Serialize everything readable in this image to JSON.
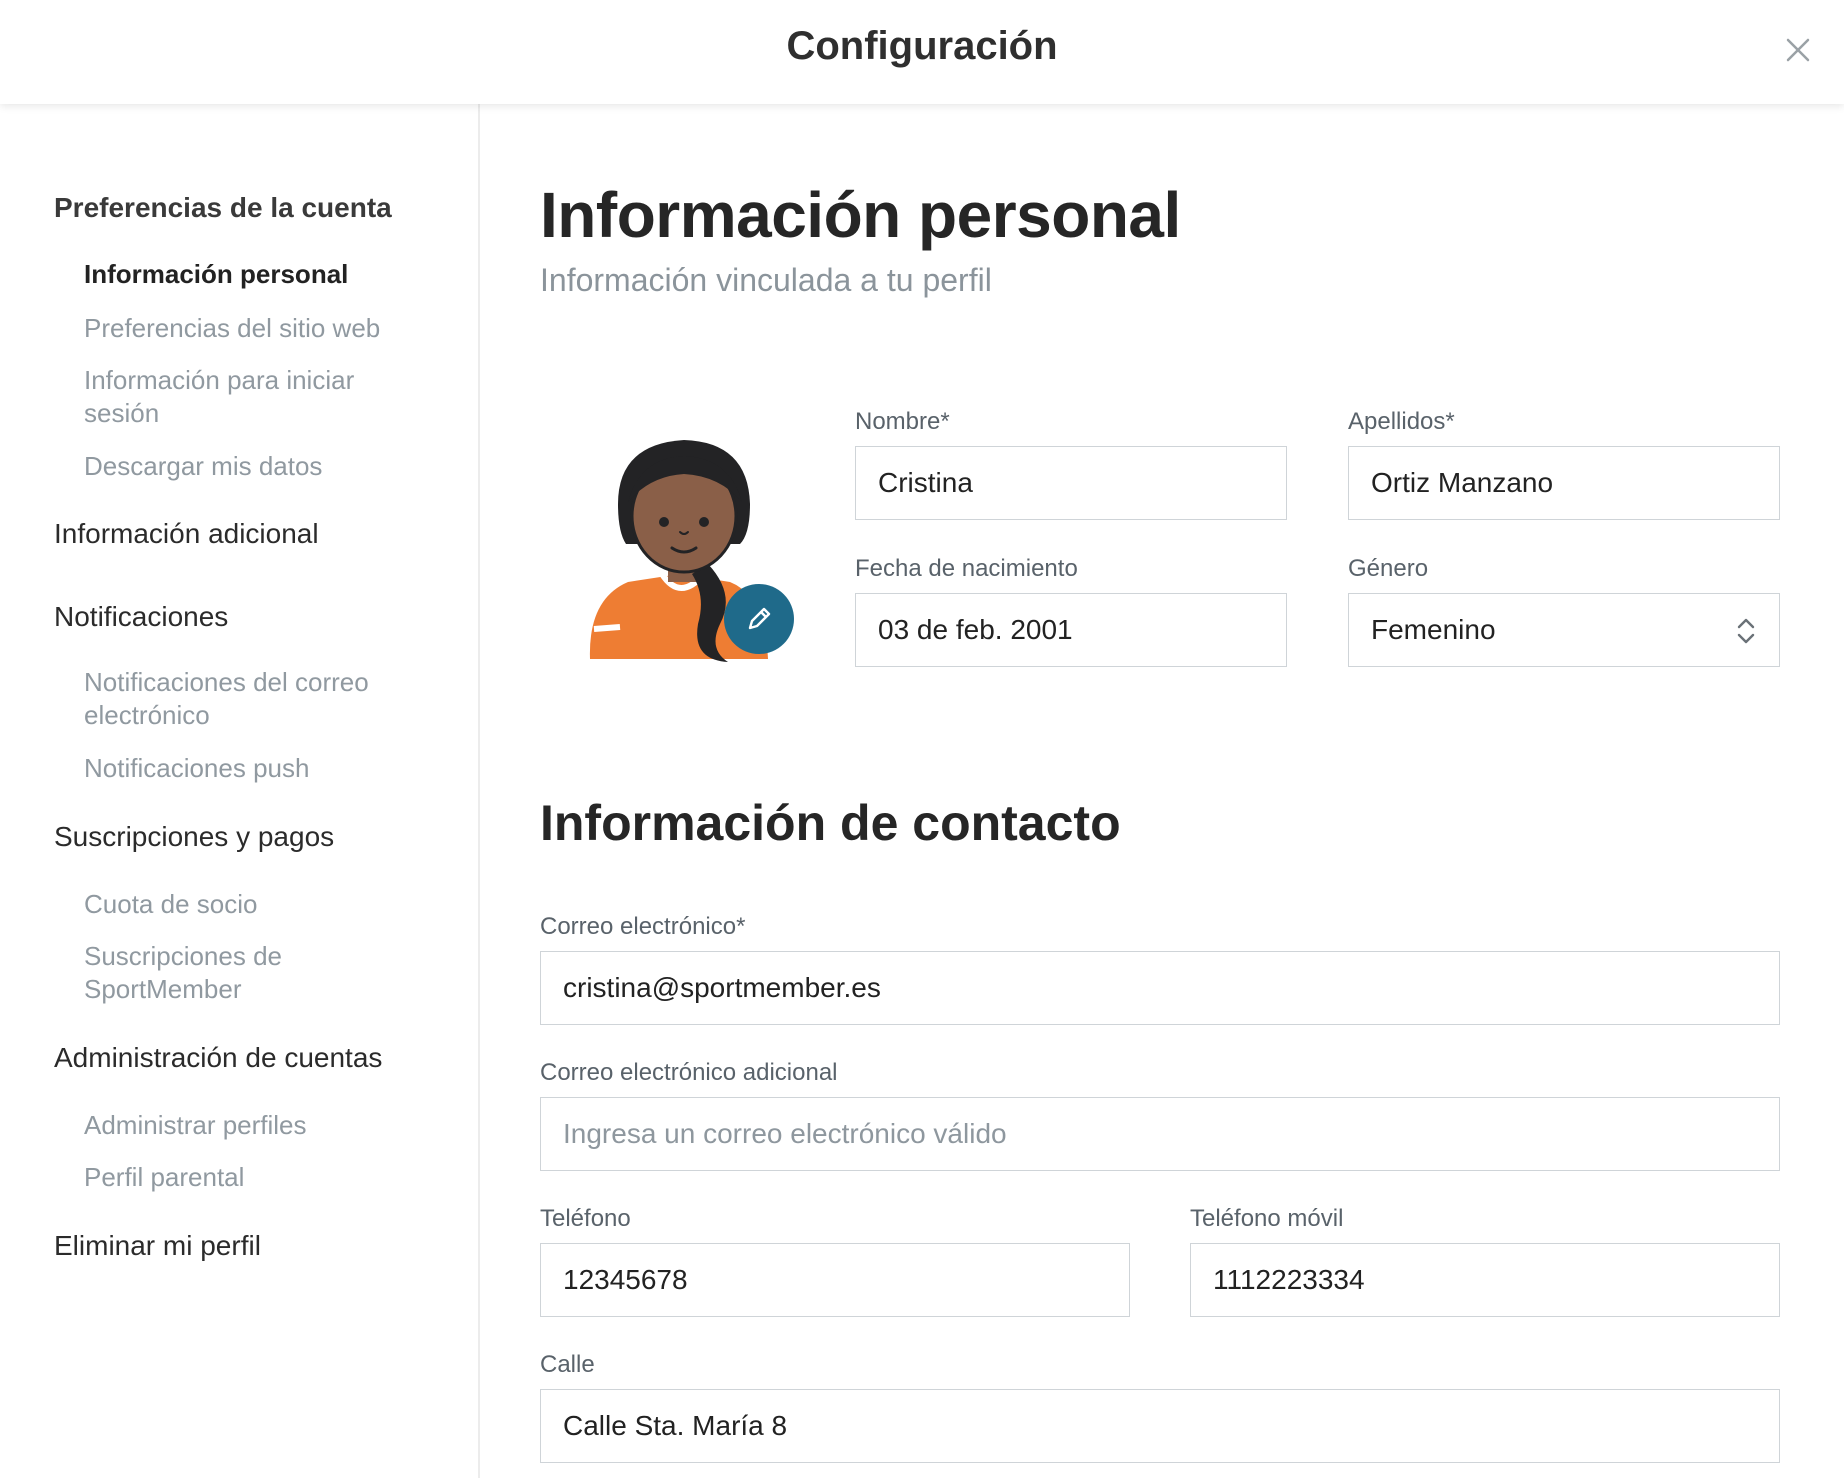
{
  "header": {
    "title": "Configuración"
  },
  "sidebar": {
    "sections": [
      {
        "label": "Preferencias de la cuenta"
      },
      {
        "label": "Información adicional"
      },
      {
        "label": "Notificaciones"
      },
      {
        "label": "Suscripciones y pagos"
      },
      {
        "label": "Administración de cuentas"
      },
      {
        "label": "Eliminar mi perfil"
      }
    ],
    "items": [
      {
        "label": "Información personal"
      },
      {
        "label": "Preferencias del sitio web"
      },
      {
        "label": "Información para iniciar sesión"
      },
      {
        "label": "Descargar mis datos"
      },
      {
        "label": "Notificaciones del correo electrónico"
      },
      {
        "label": "Notificaciones push"
      },
      {
        "label": "Cuota de socio"
      },
      {
        "label": "Suscripciones de SportMember"
      },
      {
        "label": "Administrar perfiles"
      },
      {
        "label": "Perfil parental"
      }
    ]
  },
  "main": {
    "title": "Información personal",
    "subtitle": "Información vinculada a tu perfil",
    "personal": {
      "first_name_label": "Nombre*",
      "first_name": "Cristina",
      "last_name_label": "Apellidos*",
      "last_name": "Ortiz Manzano",
      "birthdate_label": "Fecha de nacimiento",
      "birthdate": "03 de feb. 2001",
      "gender_label": "Género",
      "gender": "Femenino"
    },
    "contact": {
      "title": "Información de contacto",
      "email_label": "Correo electrónico*",
      "email": "cristina@sportmember.es",
      "extra_email_label": "Correo electrónico adicional",
      "extra_email_placeholder": "Ingresa un correo electrónico válido",
      "phone_label": "Teléfono",
      "phone": "12345678",
      "mobile_label": "Teléfono móvil",
      "mobile": "1112223334",
      "street_label": "Calle",
      "street": "Calle Sta. María 8"
    }
  },
  "colors": {
    "accent": "#1f6a8a",
    "avatar_shirt": "#ee7d33",
    "avatar_skin": "#8a5f48",
    "avatar_hair": "#232325"
  }
}
